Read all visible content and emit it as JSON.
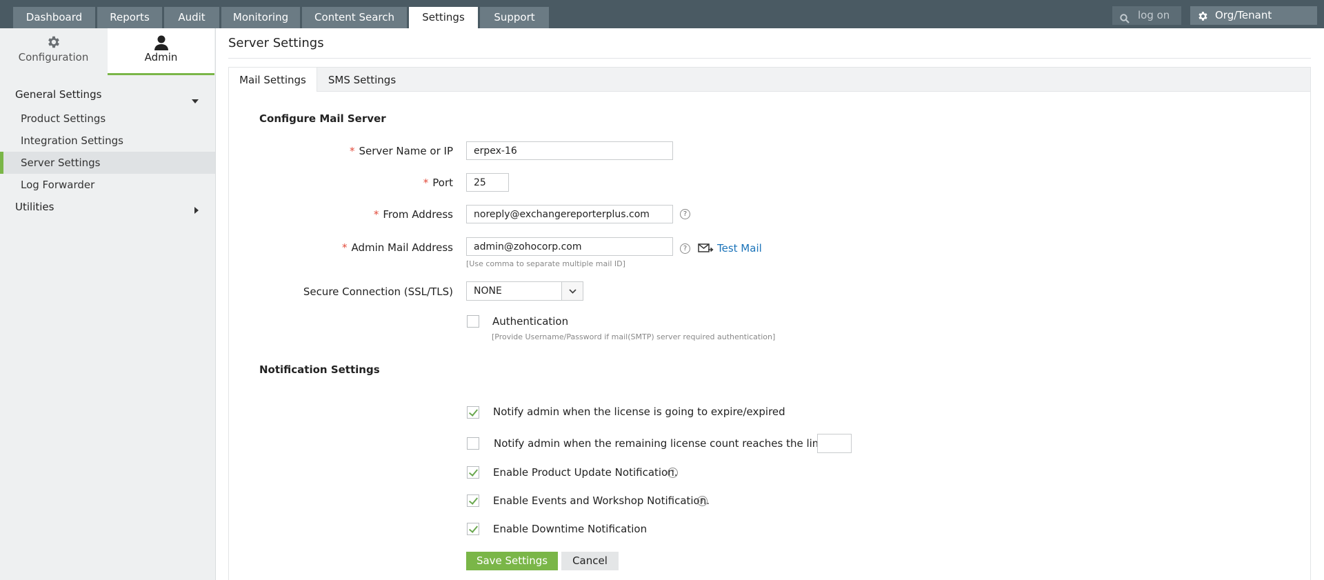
{
  "topnav": {
    "tabs": [
      "Dashboard",
      "Reports",
      "Audit",
      "Monitoring",
      "Content Search",
      "Settings",
      "Support"
    ],
    "active_tab": "Settings",
    "search_placeholder": "log on",
    "org_button": "Org/Tenant Settings"
  },
  "sidebar": {
    "tabs": {
      "configuration": "Configuration",
      "admin": "Admin"
    },
    "general_settings": "General Settings",
    "items": [
      "Product Settings",
      "Integration Settings",
      "Server Settings",
      "Log Forwarder"
    ],
    "active_item": "Server Settings",
    "utilities": "Utilities"
  },
  "main": {
    "title": "Server Settings",
    "tabs": [
      "Mail Settings",
      "SMS Settings"
    ],
    "active_tab": "Mail Settings",
    "configure_heading": "Configure Mail Server",
    "fields": {
      "server_label": "Server Name or IP",
      "server_value": "erpex-16",
      "port_label": "Port",
      "port_value": "25",
      "from_label": "From Address",
      "from_value": "noreply@exchangereporterplus.com",
      "admin_label": "Admin Mail Address",
      "admin_value": "admin@zohocorp.com",
      "admin_hint": "[Use comma to separate multiple mail ID]",
      "test_mail": "Test Mail",
      "secure_label": "Secure Connection (SSL/TLS)",
      "secure_value": "NONE",
      "auth_label": "Authentication",
      "auth_hint": "[Provide Username/Password if mail(SMTP) server required authentication]",
      "auth_checked": false,
      "required_mark": "*",
      "help_mark": "?"
    },
    "notification_heading": "Notification Settings",
    "notifications": [
      {
        "label": "Notify admin when the license is going to expire/expired",
        "checked": true
      },
      {
        "label": "Notify admin when the remaining license count reaches the limit",
        "checked": false,
        "limit_value": ""
      },
      {
        "label": "Enable Product Update Notification.",
        "checked": true
      },
      {
        "label": "Enable Events and Workshop Notification.",
        "checked": true
      },
      {
        "label": "Enable Downtime Notification",
        "checked": true
      }
    ],
    "save_label": "Save Settings",
    "cancel_label": "Cancel"
  }
}
